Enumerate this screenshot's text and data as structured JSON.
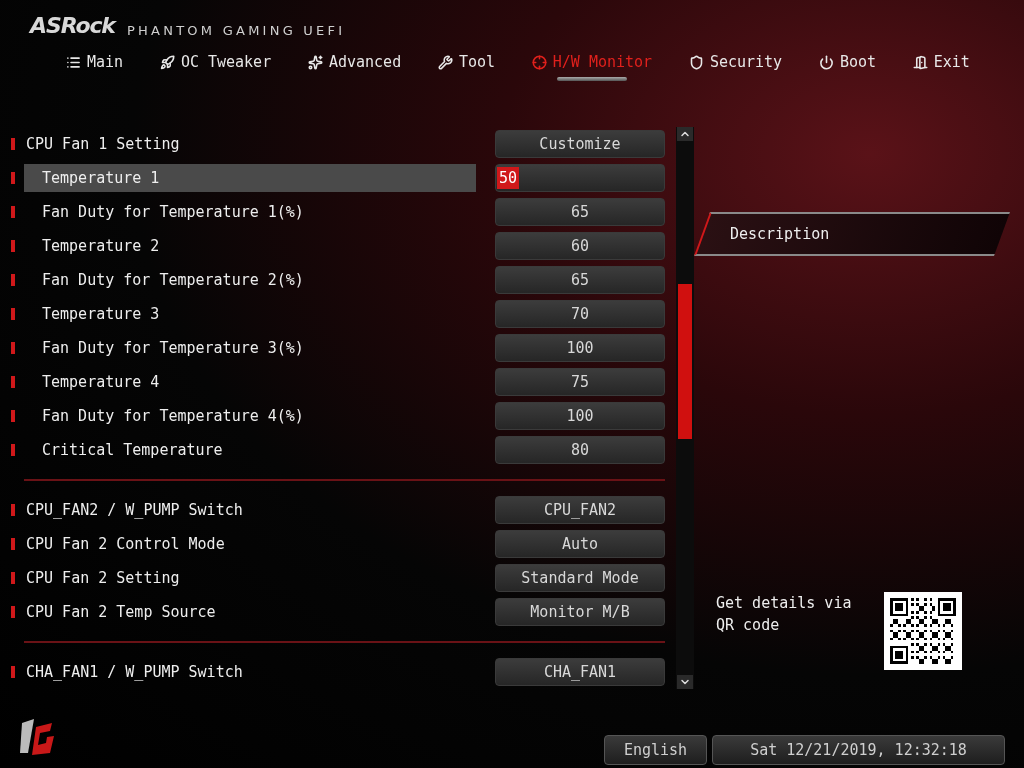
{
  "header": {
    "brand": "ASRock",
    "product": "PHANTOM GAMING UEFI"
  },
  "tabs": [
    {
      "label": "Main",
      "kind": "list",
      "selected": false
    },
    {
      "label": "OC Tweaker",
      "kind": "rocket",
      "selected": false
    },
    {
      "label": "Advanced",
      "kind": "star",
      "selected": false
    },
    {
      "label": "Tool",
      "kind": "tool",
      "selected": false
    },
    {
      "label": "H/W Monitor",
      "kind": "monitor",
      "selected": true
    },
    {
      "label": "Security",
      "kind": "shield",
      "selected": false
    },
    {
      "label": "Boot",
      "kind": "power",
      "selected": false
    },
    {
      "label": "Exit",
      "kind": "exit",
      "selected": false
    }
  ],
  "sections": [
    {
      "rows": [
        {
          "label": "CPU Fan 1 Setting",
          "value": "Customize",
          "kind": "setting",
          "selected": false
        },
        {
          "label": "Temperature 1",
          "value": "50",
          "kind": "subsetting",
          "selected": true
        },
        {
          "label": "Fan Duty for Temperature 1(%)",
          "value": "65",
          "kind": "subsetting",
          "selected": false
        },
        {
          "label": "Temperature 2",
          "value": "60",
          "kind": "subsetting",
          "selected": false
        },
        {
          "label": "Fan Duty for Temperature 2(%)",
          "value": "65",
          "kind": "subsetting",
          "selected": false
        },
        {
          "label": "Temperature 3",
          "value": "70",
          "kind": "subsetting",
          "selected": false
        },
        {
          "label": "Fan Duty for Temperature 3(%)",
          "value": "100",
          "kind": "subsetting",
          "selected": false
        },
        {
          "label": "Temperature 4",
          "value": "75",
          "kind": "subsetting",
          "selected": false
        },
        {
          "label": "Fan Duty for Temperature 4(%)",
          "value": "100",
          "kind": "subsetting",
          "selected": false
        },
        {
          "label": "Critical Temperature",
          "value": "80",
          "kind": "subsetting",
          "selected": false
        }
      ]
    },
    {
      "rows": [
        {
          "label": "CPU_FAN2 / W_PUMP Switch",
          "value": "CPU_FAN2",
          "kind": "setting",
          "selected": false
        },
        {
          "label": "CPU Fan 2 Control Mode",
          "value": "Auto",
          "kind": "setting",
          "selected": false
        },
        {
          "label": "CPU Fan 2 Setting",
          "value": "Standard Mode",
          "kind": "setting",
          "selected": false
        },
        {
          "label": "CPU Fan 2 Temp Source",
          "value": "Monitor M/B",
          "kind": "setting",
          "selected": false
        }
      ]
    },
    {
      "rows": [
        {
          "label": "CHA_FAN1 / W_PUMP Switch",
          "value": "CHA_FAN1",
          "kind": "setting",
          "selected": false
        }
      ]
    }
  ],
  "description": {
    "title": "Description",
    "qr_text": "Get details via QR code"
  },
  "footer": {
    "language": "English",
    "datetime": "Sat 12/21/2019, 12:32:18"
  }
}
